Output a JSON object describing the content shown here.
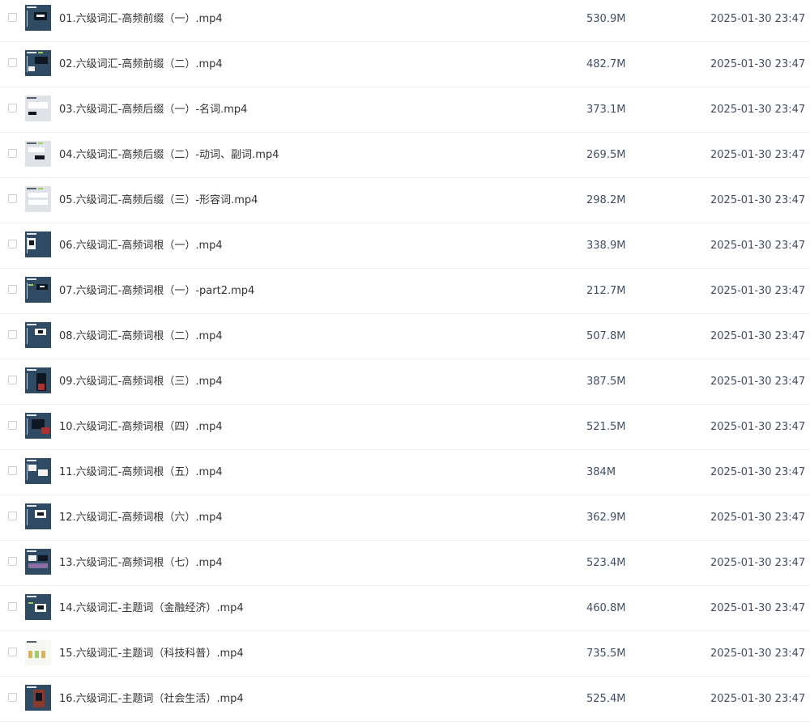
{
  "files": [
    {
      "name": "01.六级词汇-高频前缀（一）.mp4",
      "size": "530.9M",
      "modified": "2025-01-30 23:47",
      "thumbnail_icon": "video-thumbnail-icon"
    },
    {
      "name": "02.六级词汇-高频前缀（二）.mp4",
      "size": "482.7M",
      "modified": "2025-01-30 23:47",
      "thumbnail_icon": "video-thumbnail-icon"
    },
    {
      "name": "03.六级词汇-高频后缀（一）-名词.mp4",
      "size": "373.1M",
      "modified": "2025-01-30 23:47",
      "thumbnail_icon": "video-thumbnail-icon"
    },
    {
      "name": "04.六级词汇-高频后缀（二）-动词、副词.mp4",
      "size": "269.5M",
      "modified": "2025-01-30 23:47",
      "thumbnail_icon": "video-thumbnail-icon"
    },
    {
      "name": "05.六级词汇-高频后缀（三）-形容词.mp4",
      "size": "298.2M",
      "modified": "2025-01-30 23:47",
      "thumbnail_icon": "video-thumbnail-icon"
    },
    {
      "name": "06.六级词汇-高频词根（一）.mp4",
      "size": "338.9M",
      "modified": "2025-01-30 23:47",
      "thumbnail_icon": "video-thumbnail-icon"
    },
    {
      "name": "07.六级词汇-高频词根（一）-part2.mp4",
      "size": "212.7M",
      "modified": "2025-01-30 23:47",
      "thumbnail_icon": "video-thumbnail-icon"
    },
    {
      "name": "08.六级词汇-高频词根（二）.mp4",
      "size": "507.8M",
      "modified": "2025-01-30 23:47",
      "thumbnail_icon": "video-thumbnail-icon"
    },
    {
      "name": "09.六级词汇-高频词根（三）.mp4",
      "size": "387.5M",
      "modified": "2025-01-30 23:47",
      "thumbnail_icon": "video-thumbnail-icon"
    },
    {
      "name": "10.六级词汇-高频词根（四）.mp4",
      "size": "521.5M",
      "modified": "2025-01-30 23:47",
      "thumbnail_icon": "video-thumbnail-icon"
    },
    {
      "name": "11.六级词汇-高频词根（五）.mp4",
      "size": "384M",
      "modified": "2025-01-30 23:47",
      "thumbnail_icon": "video-thumbnail-icon"
    },
    {
      "name": "12.六级词汇-高频词根（六）.mp4",
      "size": "362.9M",
      "modified": "2025-01-30 23:47",
      "thumbnail_icon": "video-thumbnail-icon"
    },
    {
      "name": "13.六级词汇-高频词根（七）.mp4",
      "size": "523.4M",
      "modified": "2025-01-30 23:47",
      "thumbnail_icon": "video-thumbnail-icon"
    },
    {
      "name": "14.六级词汇-主题词（金融经济）.mp4",
      "size": "460.8M",
      "modified": "2025-01-30 23:47",
      "thumbnail_icon": "video-thumbnail-icon"
    },
    {
      "name": "15.六级词汇-主题词（科技科普）.mp4",
      "size": "735.5M",
      "modified": "2025-01-30 23:47",
      "thumbnail_icon": "video-thumbnail-icon"
    },
    {
      "name": "16.六级词汇-主题词（社会生活）.mp4",
      "size": "525.4M",
      "modified": "2025-01-30 23:47",
      "thumbnail_icon": "video-thumbnail-icon"
    }
  ],
  "colors": {
    "row_divider": "#eeeff2",
    "text_primary": "#333333",
    "text_meta": "#424e67",
    "thumbnail_bg": "#2f4a63"
  }
}
